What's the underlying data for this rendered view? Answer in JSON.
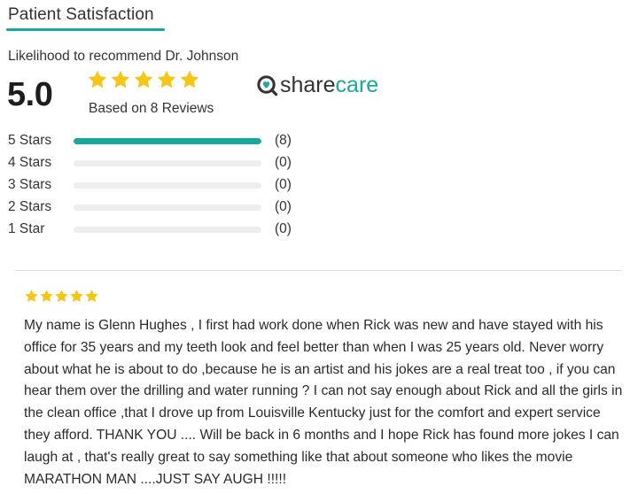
{
  "header": {
    "title": "Patient Satisfaction",
    "subtitle": "Likelihood to recommend Dr. Johnson"
  },
  "summary": {
    "score": "5.0",
    "stars": 5,
    "based_on": "Based on 8 Reviews"
  },
  "logo": {
    "icon": "sharecare-heart-search-icon",
    "text_share": "share",
    "text_care": "care"
  },
  "ratings": [
    {
      "label": "5 Stars",
      "count": "(8)",
      "fill": 1.0
    },
    {
      "label": "4 Stars",
      "count": "(0)",
      "fill": 0.0
    },
    {
      "label": "3 Stars",
      "count": "(0)",
      "fill": 0.0
    },
    {
      "label": "2 Stars",
      "count": "(0)",
      "fill": 0.0
    },
    {
      "label": "1 Star",
      "count": "(0)",
      "fill": 0.0
    }
  ],
  "review": {
    "stars": 5,
    "text": "My name is Glenn Hughes , I first had work done when Rick was new and have stayed with his office for 35 years and my teeth look and feel better than when I was 25 years old. Never worry about what he is about to do ,because he is an artist and his jokes are a real treat too , if you can hear them over the drilling and water running ? I can not say enough about Rick and all the girls in the clean office ,that I drove up from Louisville Kentucky just for the comfort and expert service they afford. THANK YOU .... Will be back in 6 months and I hope Rick has found more jokes I can laugh at , that's really great to say something like that about someone who likes the movie MARATHON MAN ....JUST SAY AUGH !!!!!"
  },
  "colors": {
    "accent": "#18a99a",
    "star": "#f5c518",
    "track": "#eeeeee",
    "text": "#333333"
  }
}
